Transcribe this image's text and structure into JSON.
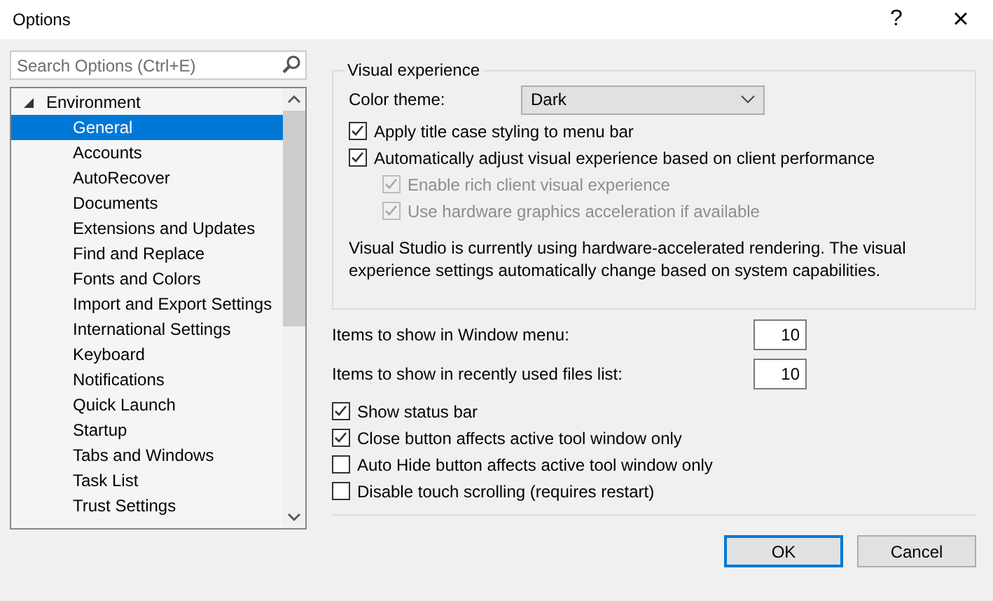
{
  "window": {
    "title": "Options",
    "help": "?",
    "close": "×"
  },
  "search": {
    "placeholder": "Search Options (Ctrl+E)"
  },
  "tree": {
    "items": [
      {
        "label": "Environment",
        "expanded": true,
        "selected": false,
        "children": [
          {
            "label": "General",
            "selected": true
          },
          {
            "label": "Accounts",
            "selected": false
          },
          {
            "label": "AutoRecover",
            "selected": false
          },
          {
            "label": "Documents",
            "selected": false
          },
          {
            "label": "Extensions and Updates",
            "selected": false
          },
          {
            "label": "Find and Replace",
            "selected": false
          },
          {
            "label": "Fonts and Colors",
            "selected": false
          },
          {
            "label": "Import and Export Settings",
            "selected": false
          },
          {
            "label": "International Settings",
            "selected": false
          },
          {
            "label": "Keyboard",
            "selected": false
          },
          {
            "label": "Notifications",
            "selected": false
          },
          {
            "label": "Quick Launch",
            "selected": false
          },
          {
            "label": "Startup",
            "selected": false
          },
          {
            "label": "Tabs and Windows",
            "selected": false
          },
          {
            "label": "Task List",
            "selected": false
          },
          {
            "label": "Trust Settings",
            "selected": false
          }
        ]
      }
    ]
  },
  "visual_experience": {
    "title": "Visual experience",
    "color_theme": {
      "label": "Color theme:",
      "value": "Dark"
    },
    "options": [
      {
        "label": "Apply title case styling to menu bar",
        "checked": true,
        "disabled": false
      },
      {
        "label": "Automatically adjust visual experience based on client performance",
        "checked": true,
        "disabled": false,
        "children": [
          {
            "label": "Enable rich client visual experience",
            "checked": true,
            "disabled": true
          },
          {
            "label": "Use hardware graphics acceleration if available",
            "checked": true,
            "disabled": true
          }
        ]
      }
    ],
    "note": "Visual Studio is currently using hardware-accelerated rendering. The visual experience settings automatically change based on system capabilities."
  },
  "fields": [
    {
      "label": "Items to show in Window menu:",
      "value": "10"
    },
    {
      "label": "Items to show in recently used files list:",
      "value": "10"
    }
  ],
  "checkboxes": [
    {
      "label": "Show status bar",
      "checked": true
    },
    {
      "label": "Close button affects active tool window only",
      "checked": true
    },
    {
      "label": "Auto Hide button affects active tool window only",
      "checked": false
    },
    {
      "label": "Disable touch scrolling (requires restart)",
      "checked": false
    }
  ],
  "buttons": [
    {
      "label": "OK",
      "default": true
    },
    {
      "label": "Cancel",
      "default": false
    }
  ]
}
